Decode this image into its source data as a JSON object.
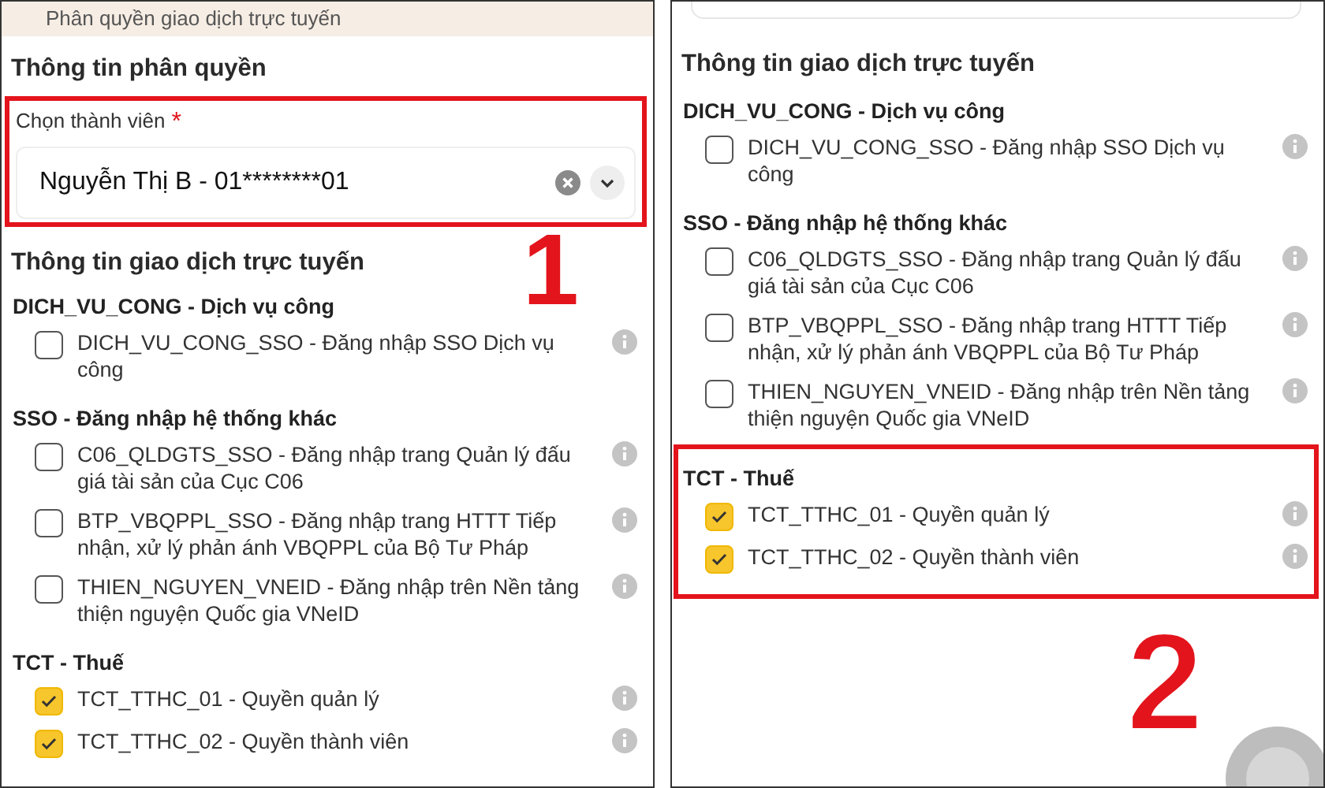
{
  "panels": [
    {
      "header": {
        "title": "Phân quyền giao dịch trực tuyến"
      },
      "member_section": {
        "title": "Thông tin phân quyền",
        "field_label": "Chọn thành viên",
        "required_mark": "*",
        "value": "Nguyễn Thị B - 01********01",
        "highlighted": true,
        "annotation": "1"
      },
      "permissions": {
        "title": "Thông tin giao dịch trực tuyến",
        "groups": [
          {
            "title": "DICH_VU_CONG - Dịch vụ công",
            "highlighted": false,
            "items": [
              {
                "label": "DICH_VU_CONG_SSO - Đăng nhập SSO Dịch vụ công",
                "checked": false
              }
            ]
          },
          {
            "title": "SSO - Đăng nhập hệ thống khác",
            "highlighted": false,
            "items": [
              {
                "label": "C06_QLDGTS_SSO - Đăng nhập trang Quản lý đấu giá tài sản của Cục C06",
                "checked": false
              },
              {
                "label": "BTP_VBQPPL_SSO - Đăng nhập trang HTTT Tiếp nhận, xử lý phản ánh VBQPPL của Bộ Tư Pháp",
                "checked": false
              },
              {
                "label": "THIEN_NGUYEN_VNEID - Đăng nhập trên Nền tảng thiện nguyện Quốc gia VNeID",
                "checked": false
              }
            ]
          },
          {
            "title": "TCT - Thuế",
            "highlighted": false,
            "items": [
              {
                "label": "TCT_TTHC_01 - Quyền quản lý",
                "checked": true
              },
              {
                "label": "TCT_TTHC_02 - Quyền thành viên",
                "checked": true
              }
            ]
          }
        ]
      }
    },
    {
      "permissions": {
        "title": "Thông tin giao dịch trực tuyến",
        "groups": [
          {
            "title": "DICH_VU_CONG - Dịch vụ công",
            "highlighted": false,
            "items": [
              {
                "label": "DICH_VU_CONG_SSO - Đăng nhập SSO Dịch vụ công",
                "checked": false
              }
            ]
          },
          {
            "title": "SSO - Đăng nhập hệ thống khác",
            "highlighted": false,
            "items": [
              {
                "label": "C06_QLDGTS_SSO - Đăng nhập trang Quản lý đấu giá tài sản của Cục C06",
                "checked": false
              },
              {
                "label": "BTP_VBQPPL_SSO - Đăng nhập trang HTTT Tiếp nhận, xử lý phản ánh VBQPPL của Bộ Tư Pháp",
                "checked": false
              },
              {
                "label": "THIEN_NGUYEN_VNEID - Đăng nhập trên Nền tảng thiện nguyện Quốc gia VNeID",
                "checked": false
              }
            ]
          },
          {
            "title": "TCT - Thuế",
            "highlighted": true,
            "annotation": "2",
            "items": [
              {
                "label": "TCT_TTHC_01 - Quyền quản lý",
                "checked": true
              },
              {
                "label": "TCT_TTHC_02 - Quyền thành viên",
                "checked": true
              }
            ]
          }
        ]
      }
    }
  ]
}
